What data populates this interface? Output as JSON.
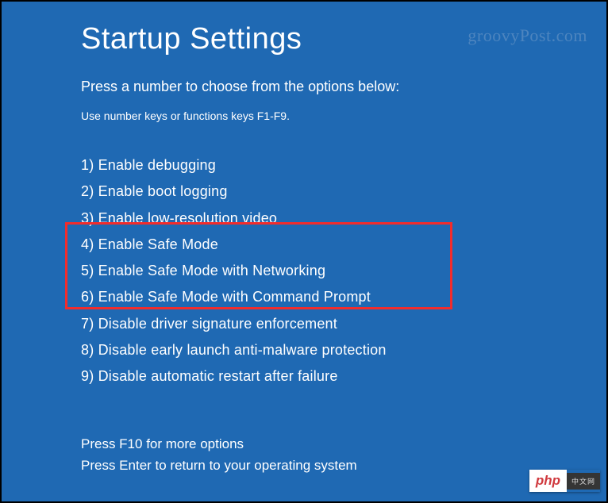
{
  "title": "Startup Settings",
  "subtitle": "Press a number to choose from the options below:",
  "hint": "Use number keys or functions keys F1-F9.",
  "options": [
    "1) Enable debugging",
    "2) Enable boot logging",
    "3) Enable low-resolution video",
    "4) Enable Safe Mode",
    "5) Enable Safe Mode with Networking",
    "6) Enable Safe Mode with Command Prompt",
    "7) Disable driver signature enforcement",
    "8) Disable early launch anti-malware protection",
    "9) Disable automatic restart after failure"
  ],
  "footer": {
    "more": "Press F10 for more options",
    "back": "Press Enter to return to your operating system"
  },
  "watermark_top": "groovyPost.com",
  "watermark_bottom": {
    "left": "php",
    "right": "中文网"
  }
}
